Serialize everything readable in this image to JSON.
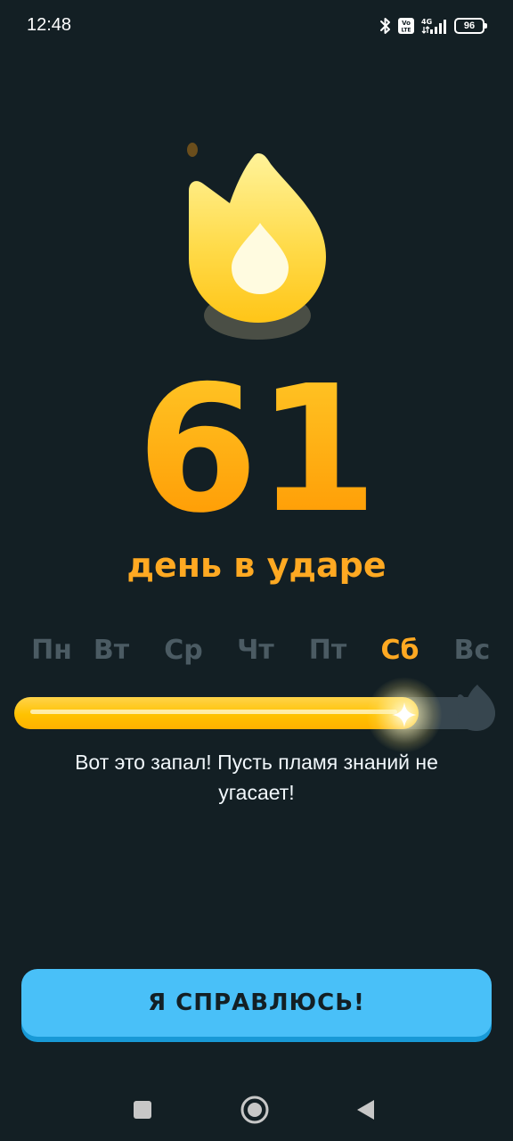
{
  "status_bar": {
    "time": "12:48",
    "network": "4G",
    "volte": "Vo LTE",
    "battery_level": "96",
    "icons": [
      "bluetooth-icon",
      "volte-icon",
      "signal-icon",
      "battery-icon"
    ]
  },
  "streak": {
    "count": "61",
    "label": "день в ударе",
    "icon": "flame-icon"
  },
  "week": {
    "days": [
      "Пн",
      "Вт",
      "Ср",
      "Чт",
      "Пт",
      "Сб",
      "Вс"
    ],
    "active_day": "Сб",
    "progress": 0.84
  },
  "message": "Вот это запал! Пусть пламя знаний не угасает!",
  "cta": {
    "label": "Я СПРАВЛЮСЬ!"
  },
  "nav": {
    "items": [
      "recents-icon",
      "home-icon",
      "back-icon"
    ]
  },
  "colors": {
    "background": "#131f24",
    "accent_orange": "#ffa922",
    "button_blue": "#49c0f8",
    "button_shadow": "#1899d6",
    "inactive_gray": "#4b5b63",
    "track": "#37464f"
  }
}
